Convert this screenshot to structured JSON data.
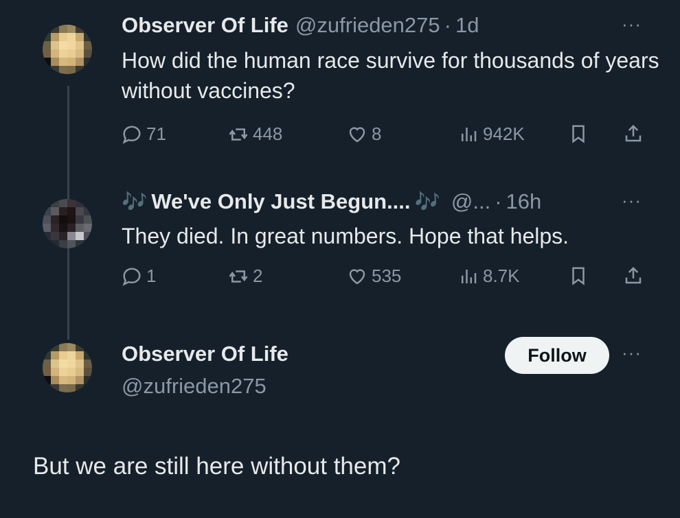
{
  "colors": {
    "background": "#15202b",
    "text": "#e7e9ea",
    "muted": "#8b98a5",
    "follow_bg": "#eff3f4"
  },
  "tweet1": {
    "name": "Observer Of Life",
    "handle": "@zufrieden275",
    "separator": "·",
    "time": "1d",
    "text": "How did the human race survive for thousands of years without vaccines?",
    "stats": {
      "replies": "71",
      "retweets": "448",
      "likes": "8",
      "views": "942K"
    },
    "more_label": "···"
  },
  "tweet2": {
    "name_prefix": "🎶",
    "name": "We've Only Just Begun....",
    "name_suffix": "🎶",
    "handle": "@...",
    "separator": "·",
    "time": "16h",
    "text": "They died. In great numbers. Hope that helps.",
    "stats": {
      "replies": "1",
      "retweets": "2",
      "likes": "535",
      "views": "8.7K"
    },
    "more_label": "···"
  },
  "main_tweet": {
    "name": "Observer Of Life",
    "handle": "@zufrieden275",
    "follow_label": "Follow",
    "more_label": "···",
    "text": "But we are still here without them?"
  },
  "icons": [
    "reply-icon",
    "retweet-icon",
    "like-icon",
    "views-icon",
    "bookmark-icon",
    "share-icon",
    "more-icon"
  ]
}
